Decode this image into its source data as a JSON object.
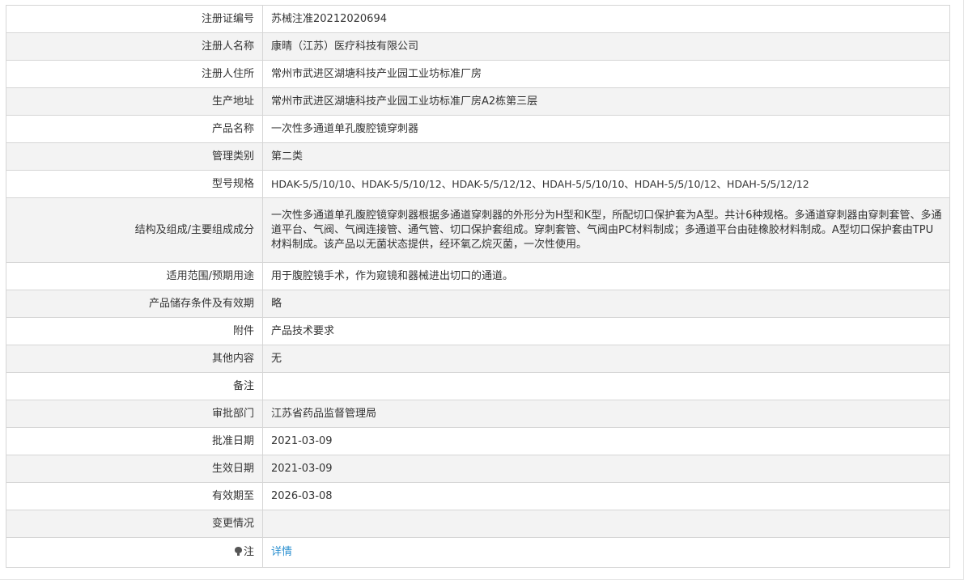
{
  "rows": [
    {
      "label": "注册证编号",
      "value": "苏械注准20212020694"
    },
    {
      "label": "注册人名称",
      "value": "康晴（江苏）医疗科技有限公司"
    },
    {
      "label": "注册人住所",
      "value": "常州市武进区湖塘科技产业园工业坊标准厂房"
    },
    {
      "label": "生产地址",
      "value": "常州市武进区湖塘科技产业园工业坊标准厂房A2栋第三层"
    },
    {
      "label": "产品名称",
      "value": "一次性多通道单孔腹腔镜穿刺器"
    },
    {
      "label": "管理类别",
      "value": "第二类"
    },
    {
      "label": "型号规格",
      "value": "HDAK-5/5/10/10、HDAK-5/5/10/12、HDAK-5/5/12/12、HDAH-5/5/10/10、HDAH-5/5/10/12、HDAH-5/5/12/12"
    },
    {
      "label": "结构及组成/主要组成成分",
      "value": "一次性多通道单孔腹腔镜穿刺器根据多通道穿刺器的外形分为H型和K型，所配切口保护套为A型。共计6种规格。多通道穿刺器由穿刺套管、多通道平台、气阀、气阀连接管、通气管、切口保护套组成。穿刺套管、气阀由PC材料制成；多通道平台由硅橡胶材料制成。A型切口保护套由TPU材料制成。该产品以无菌状态提供，经环氧乙烷灭菌，一次性使用。"
    },
    {
      "label": "适用范围/预期用途",
      "value": "用于腹腔镜手术，作为窥镜和器械进出切口的通道。"
    },
    {
      "label": "产品储存条件及有效期",
      "value": "略"
    },
    {
      "label": "附件",
      "value": "产品技术要求"
    },
    {
      "label": "其他内容",
      "value": "无"
    },
    {
      "label": "备注",
      "value": ""
    },
    {
      "label": "审批部门",
      "value": "江苏省药品监督管理局"
    },
    {
      "label": "批准日期",
      "value": "2021-03-09"
    },
    {
      "label": "生效日期",
      "value": "2021-03-09"
    },
    {
      "label": "有效期至",
      "value": "2026-03-08"
    },
    {
      "label": "变更情况",
      "value": ""
    }
  ],
  "note": {
    "icon": "lightbulb-icon",
    "label": "注",
    "link_text": "详情",
    "link_color": "#2a8fd0"
  },
  "colors": {
    "border": "#d6d6d6",
    "alt_row_bg": "#f3f3f3",
    "text": "#333333"
  }
}
